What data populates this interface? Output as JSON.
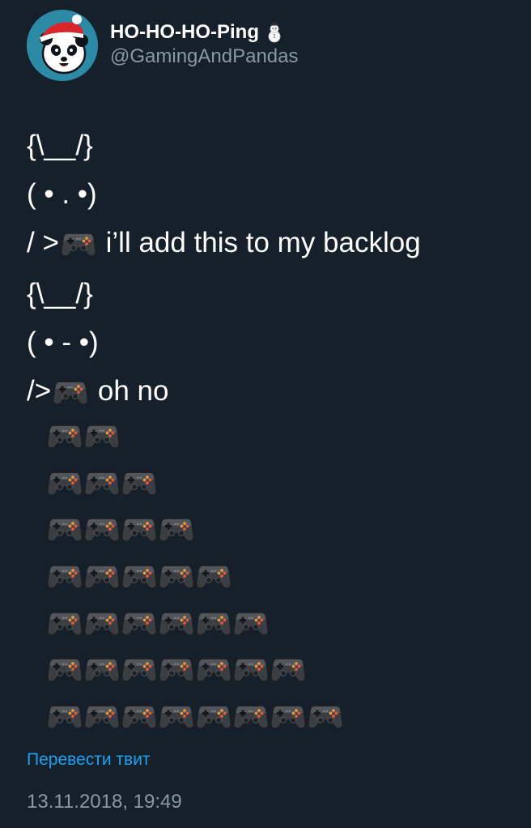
{
  "tweet": {
    "display_name": "HO-HO-HO-Ping",
    "handle": "@GamingAndPandas",
    "lines": {
      "l1": "{\\__/}",
      "l2": "( • . •)",
      "l3_prefix": "/ >",
      "l3_suffix": " i’ll add this to my backlog",
      "l4": "{\\__/}",
      "l5": "( • - •)",
      "l6_prefix": "/>",
      "l6_suffix": " oh no"
    },
    "pile_rows": [
      2,
      3,
      4,
      5,
      6,
      7,
      8
    ],
    "translate_label": "Перевести твит",
    "timestamp": "13.11.2018, 19:49"
  },
  "icons": {
    "avatar": "panda-santa-hat-avatar",
    "name_emoji": "snowman-icon",
    "game_emoji": "video-game-controller-icon"
  },
  "colors": {
    "background": "#15202b",
    "text": "#ffffff",
    "secondary": "#8899a6",
    "link": "#1da1f2"
  }
}
